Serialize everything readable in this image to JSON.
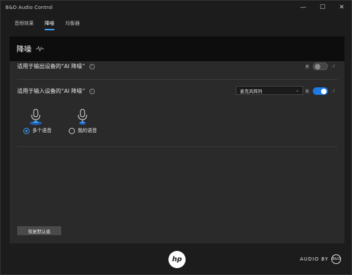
{
  "window": {
    "title": "B&O Audio Control",
    "minimize_glyph": "—",
    "maximize_glyph": "☐",
    "close_glyph": "✕"
  },
  "tabs": [
    {
      "label": "音频效果",
      "active": false
    },
    {
      "label": "降噪",
      "active": true
    },
    {
      "label": "均衡器",
      "active": false
    }
  ],
  "panel": {
    "title": "降噪",
    "output_row": {
      "label": "适用于输出设备的“AI 降噪”",
      "toggle_state": "关",
      "enabled": false,
      "bar_glyph": ".ıl"
    },
    "input_row": {
      "label": "适用于输入设备的“AI 降噪”",
      "device_select": "麦克风阵列",
      "toggle_state": "关",
      "enabled": true,
      "bar_glyph": ".ıl"
    },
    "modes": [
      {
        "label": "多个语音",
        "selected": true,
        "icon": "microphone-multi-icon"
      },
      {
        "label": "我的语音",
        "selected": false,
        "icon": "microphone-single-icon"
      }
    ],
    "reset_button": "恢复默认值"
  },
  "footer": {
    "hp_logo": "hp",
    "audio_by": "AUDIO BY",
    "bo_logo": "B&O"
  },
  "colors": {
    "accent": "#1e7be6",
    "panel_bg": "#2a2a2a",
    "header_bg": "#0d0d0d",
    "window_bg": "#1c1c1c"
  }
}
